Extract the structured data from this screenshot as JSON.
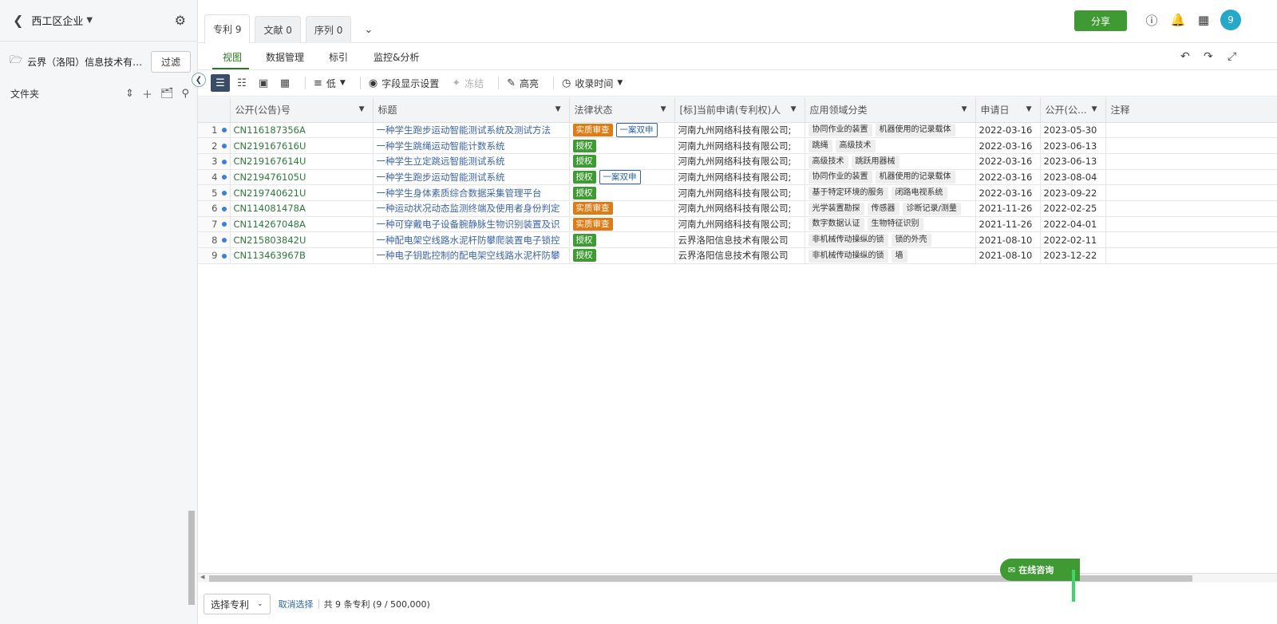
{
  "sidebar": {
    "title": "西工区企业",
    "org_name": "云界（洛阳）信息技术有限...",
    "filter_label": "过滤",
    "folders_label": "文件夹"
  },
  "tabs": [
    {
      "label": "专利 9"
    },
    {
      "label": "文献 0"
    },
    {
      "label": "序列 0"
    }
  ],
  "topbar": {
    "share_label": "分享",
    "avatar_text": "9"
  },
  "subnav": [
    {
      "label": "视图"
    },
    {
      "label": "数据管理"
    },
    {
      "label": "标引"
    },
    {
      "label": "监控&分析"
    }
  ],
  "toolbar": {
    "density_label": "低",
    "fields_label": "字段显示设置",
    "freeze_label": "冻结",
    "highlight_label": "高亮",
    "sort_label": "收录时间"
  },
  "table": {
    "columns": [
      "公开(公告)号",
      "标题",
      "法律状态",
      "[标]当前申请(专利权)人",
      "应用领域分类",
      "申请日",
      "公开(公...",
      "注释"
    ],
    "rows": [
      {
        "idx": "1",
        "pn": "CN116187356A",
        "title": "一种学生跑步运动智能测试系统及测试方法",
        "status": "实质审查",
        "status_type": "exam",
        "dual": "一案双申",
        "applicant": "河南九州网络科技有限公司;",
        "fields": [
          "协同作业的装置",
          "机器使用的记录载体"
        ],
        "apply_date": "2022-03-16",
        "pub_date": "2023-05-30"
      },
      {
        "idx": "2",
        "pn": "CN219167616U",
        "title": "一种学生跳绳运动智能计数系统",
        "status": "授权",
        "status_type": "grant",
        "dual": "",
        "applicant": "河南九州网络科技有限公司;",
        "fields": [
          "跳绳",
          "高级技术"
        ],
        "apply_date": "2022-03-16",
        "pub_date": "2023-06-13"
      },
      {
        "idx": "3",
        "pn": "CN219167614U",
        "title": "一种学生立定跳远智能测试系统",
        "status": "授权",
        "status_type": "grant",
        "dual": "",
        "applicant": "河南九州网络科技有限公司;",
        "fields": [
          "高级技术",
          "跳跃用器械"
        ],
        "apply_date": "2022-03-16",
        "pub_date": "2023-06-13"
      },
      {
        "idx": "4",
        "pn": "CN219476105U",
        "title": "一种学生跑步运动智能测试系统",
        "status": "授权",
        "status_type": "grant",
        "dual": "一案双申",
        "applicant": "河南九州网络科技有限公司;",
        "fields": [
          "协同作业的装置",
          "机器使用的记录载体"
        ],
        "apply_date": "2022-03-16",
        "pub_date": "2023-08-04"
      },
      {
        "idx": "5",
        "pn": "CN219740621U",
        "title": "一种学生身体素质综合数据采集管理平台",
        "status": "授权",
        "status_type": "grant",
        "dual": "",
        "applicant": "河南九州网络科技有限公司;",
        "fields": [
          "基于特定环境的服务",
          "闭路电视系统"
        ],
        "apply_date": "2022-03-16",
        "pub_date": "2023-09-22"
      },
      {
        "idx": "6",
        "pn": "CN114081478A",
        "title": "一种运动状况动态监测终端及使用者身份判定",
        "status": "实质审查",
        "status_type": "exam",
        "dual": "",
        "applicant": "河南九州网络科技有限公司;",
        "fields": [
          "光学装置勘探",
          "传感器",
          "诊断记录/测量"
        ],
        "apply_date": "2021-11-26",
        "pub_date": "2022-02-25"
      },
      {
        "idx": "7",
        "pn": "CN114267048A",
        "title": "一种可穿戴电子设备腕静脉生物识别装置及识",
        "status": "实质审查",
        "status_type": "exam",
        "dual": "",
        "applicant": "河南九州网络科技有限公司;",
        "fields": [
          "数字数据认证",
          "生物特征识别"
        ],
        "apply_date": "2021-11-26",
        "pub_date": "2022-04-01"
      },
      {
        "idx": "8",
        "pn": "CN215803842U",
        "title": "一种配电架空线路水泥杆防攀爬装置电子锁控",
        "status": "授权",
        "status_type": "grant",
        "dual": "",
        "applicant": "云界洛阳信息技术有限公司",
        "fields": [
          "非机械传动操纵的锁",
          "锁的外壳"
        ],
        "apply_date": "2021-08-10",
        "pub_date": "2022-02-11"
      },
      {
        "idx": "9",
        "pn": "CN113463967B",
        "title": "一种电子钥匙控制的配电架空线路水泥杆防攀",
        "status": "授权",
        "status_type": "grant",
        "dual": "",
        "applicant": "云界洛阳信息技术有限公司",
        "fields": [
          "非机械传动操纵的锁",
          "墙"
        ],
        "apply_date": "2021-08-10",
        "pub_date": "2023-12-22"
      }
    ]
  },
  "footer": {
    "select_label": "选择专利",
    "cancel_label": "取消选择",
    "count_text": "共 9 条专利 (9 / 500,000)"
  },
  "chat": {
    "label": "在线咨询"
  },
  "colors": {
    "accent_green": "#3f9a33",
    "link_blue": "#3c64a8",
    "patent_green": "#2c7a3a",
    "exam_orange": "#e07a12",
    "avatar_blue": "#26a8c9"
  }
}
